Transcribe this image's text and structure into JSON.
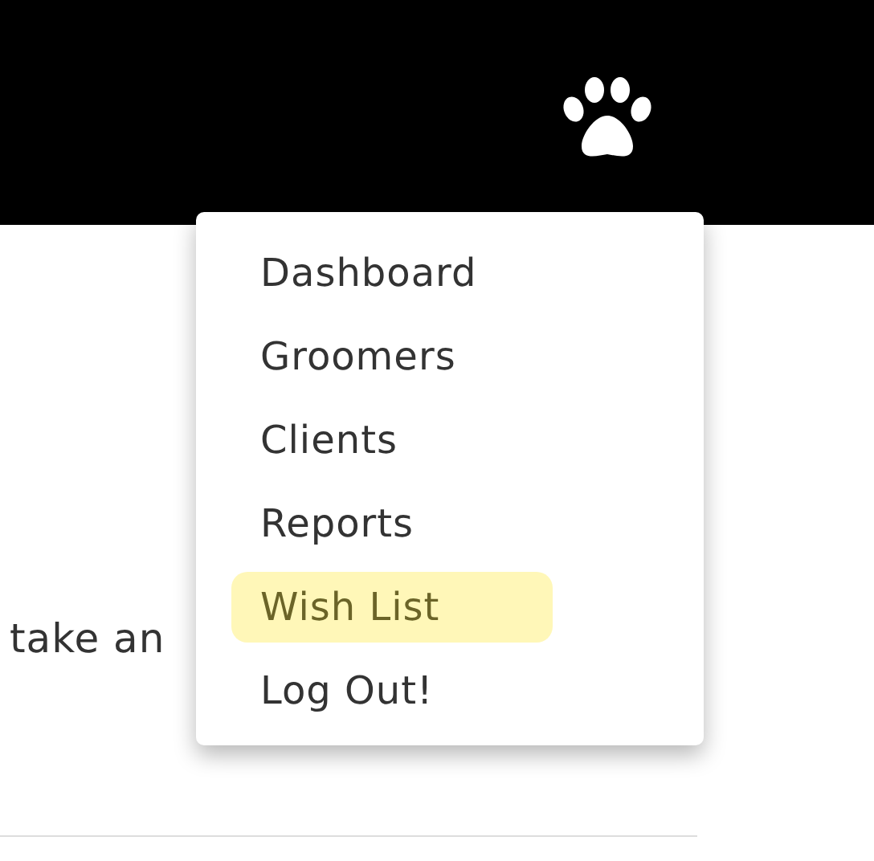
{
  "body_text": "take an",
  "menu": {
    "items": [
      {
        "label": "Dashboard",
        "selected": false
      },
      {
        "label": "Groomers",
        "selected": false
      },
      {
        "label": "Clients",
        "selected": false
      },
      {
        "label": "Reports",
        "selected": false
      },
      {
        "label": "Wish List",
        "selected": true
      },
      {
        "label": "Log Out!",
        "selected": false
      }
    ]
  }
}
